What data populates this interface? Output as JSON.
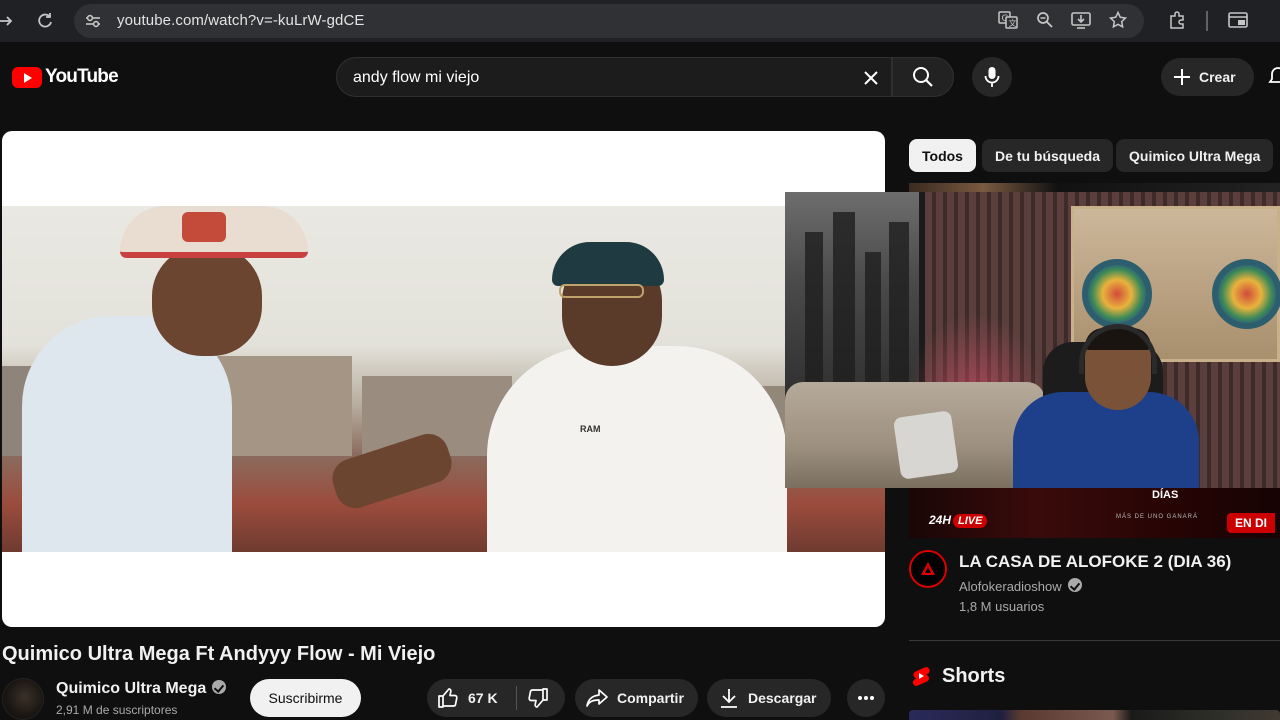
{
  "browser": {
    "url": "youtube.com/watch?v=-kuLrW-gdCE"
  },
  "header": {
    "logo_text": "YouTube",
    "search_query": "andy flow mi viejo",
    "create_label": "Crear"
  },
  "video": {
    "title": "Quimico Ultra Mega Ft Andyyy Flow - Mi Viejo",
    "channel_name": "Quimico Ultra Mega",
    "subscribers": "2,91 M de suscriptores",
    "subscribe_label": "Suscribirme",
    "likes": "67 K",
    "share_label": "Compartir",
    "download_label": "Descargar",
    "overlay_logo_text": "RAM"
  },
  "sidebar": {
    "chips": [
      "Todos",
      "De tu búsqueda",
      "Quimico Ultra Mega"
    ],
    "recommendation": {
      "title": "LA CASA DE ALOFOKE 2 (DIA 36)",
      "channel": "Alofokeradioshow",
      "viewers": "1,8 M usuarios",
      "thumb_badge": "24H",
      "thumb_live": "LIVE",
      "thumb_days": "DÍAS",
      "thumb_tag": "MÁS DE UNO GANARÁ",
      "thumb_live_now": "EN DI"
    },
    "shorts_label": "Shorts"
  },
  "colors": {
    "background": "#0f0f0f",
    "brand_red": "#ff0000",
    "pill_bg": "#272727",
    "live_red": "#cc0000"
  }
}
